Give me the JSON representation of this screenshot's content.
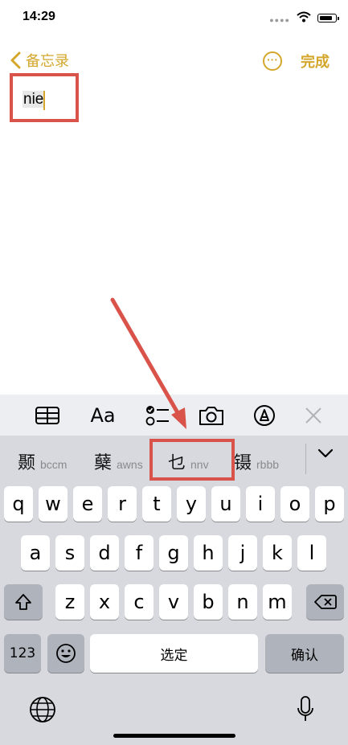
{
  "status_bar": {
    "time": "14:29"
  },
  "nav": {
    "back_label": "备忘录",
    "done_label": "完成",
    "more_symbol": "···"
  },
  "note": {
    "typed_text": "nie"
  },
  "toolbar": {
    "icons": [
      "table-icon",
      "text-format-icon",
      "checklist-icon",
      "camera-icon",
      "markup-icon",
      "close-icon"
    ],
    "format_label": "Aa"
  },
  "candidates": [
    {
      "char": "颞",
      "code": "bccm"
    },
    {
      "char": "蘖",
      "code": "awns"
    },
    {
      "char": "乜",
      "code": "nnv"
    },
    {
      "char": "镊",
      "code": "rbbb"
    }
  ],
  "keyboard": {
    "row1": [
      "q",
      "w",
      "e",
      "r",
      "t",
      "y",
      "u",
      "i",
      "o",
      "p"
    ],
    "row2": [
      "a",
      "s",
      "d",
      "f",
      "g",
      "h",
      "j",
      "k",
      "l"
    ],
    "row3": [
      "z",
      "x",
      "c",
      "v",
      "b",
      "n",
      "m"
    ],
    "num_label": "123",
    "space_label": "选定",
    "confirm_label": "确认"
  },
  "colors": {
    "accent": "#d4a72c",
    "annotation": "#d9534a",
    "keyboard_bg": "#d7d9de"
  }
}
